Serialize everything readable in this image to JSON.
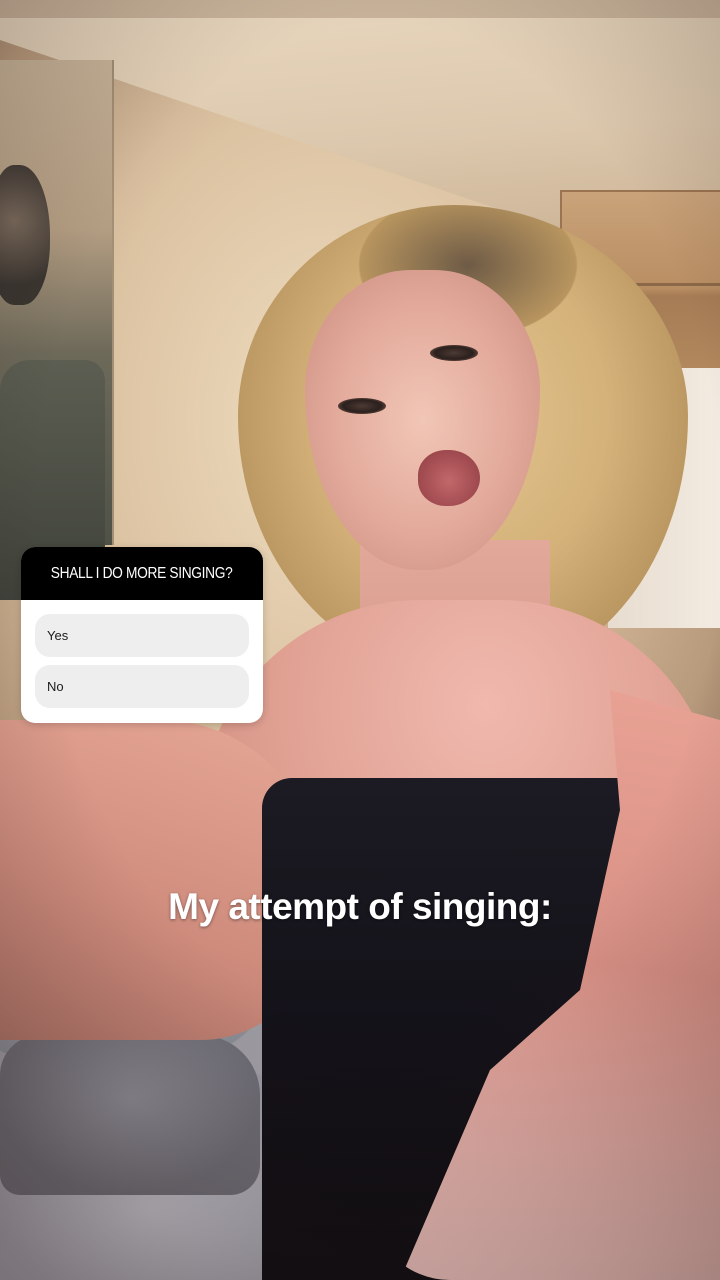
{
  "poll": {
    "question": "SHALL I DO MORE SINGING?",
    "options": [
      {
        "label": "Yes"
      },
      {
        "label": "No"
      }
    ]
  },
  "caption": {
    "text": "My attempt of singing:"
  },
  "colors": {
    "poll_header_bg": "#000000",
    "poll_option_bg": "#efeeef",
    "caption_text": "#ffffff"
  }
}
